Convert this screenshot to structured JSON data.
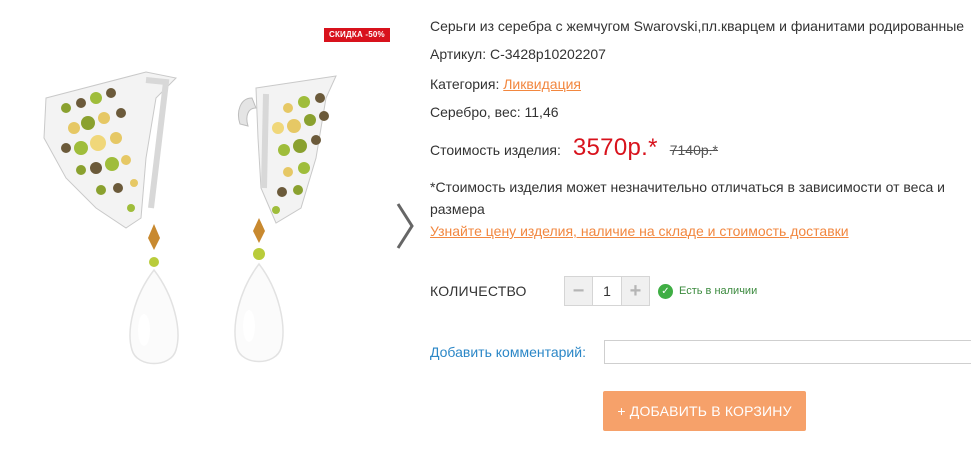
{
  "badge": {
    "discount": "СКИДКА -50%"
  },
  "product": {
    "title": "Серьги из серебра с жемчугом Swarovski,пл.кварцем и фианитами родированные",
    "sku": "Артикул: С-3428р10202207",
    "category_label": "Категория: ",
    "category_value": "Ликвидация",
    "weight": "Серебро, вес: 11,46",
    "price_label": "Стоимость изделия:",
    "price": "3570р.*",
    "old_price": "7140р.*",
    "note": "*Стоимость изделия может незначительно отличаться в зависимости от веса и размера",
    "info_link": "Узнайте цену изделия, наличие на складе и стоимость доставки"
  },
  "quantity": {
    "label": "КОЛИЧЕСТВО",
    "value": "1",
    "minus": "−",
    "plus": "+",
    "stock_status": "Есть в наличии"
  },
  "comment": {
    "label": "Добавить комментарий:",
    "value": ""
  },
  "cart": {
    "add_label": "+ ДОБАВИТЬ В КОРЗИНУ"
  },
  "colors": {
    "price_red": "#d8121c",
    "link_orange": "#f2873f",
    "button_orange": "#f6a16a",
    "comment_blue": "#2b87c7",
    "stock_green": "#3fae44"
  }
}
